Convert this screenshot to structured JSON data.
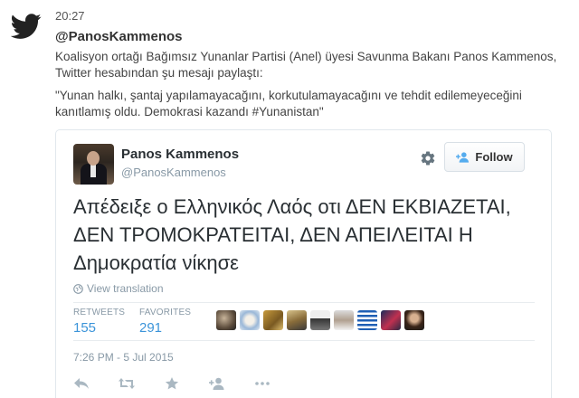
{
  "header": {
    "time": "20:27",
    "handle": "@PanosKammenos",
    "description": "Koalisyon ortağı Bağımsız Yunanlar Partisi (Anel) üyesi Savunma Bakanı Panos Kammenos, Twitter hesabından şu mesajı paylaştı:",
    "quote": "\"Yunan halkı, şantaj yapılamayacağını, korkutulamayacağını ve tehdit edilemeyeceğini kanıtlamış oldu. Demokrasi kazandı #Yunanistan\""
  },
  "tweet": {
    "name": "Panos Kammenos",
    "screen_name": "@PanosKammenos",
    "follow_label": "Follow",
    "text": "Απέδειξε ο Ελληνικός Λαός οτι ΔΕΝ ΕΚΒΙΑΖΕΤΑΙ, ΔΕΝ ΤΡΟΜΟΚΡΑΤΕΙΤΑΙ, ΔΕΝ ΑΠΕΙΛΕΙΤΑΙ Η Δημοκρατία νίκησε",
    "view_translation": "View translation",
    "stats": {
      "retweets_label": "RETWEETS",
      "retweets": "155",
      "favorites_label": "FAVORITES",
      "favorites": "291"
    },
    "timestamp": "7:26 PM - 5 Jul 2015"
  },
  "colors": {
    "twitter_blue": "#3b94d9",
    "bird": "#222222",
    "muted": "#8899a6"
  },
  "icons": [
    "twitter-bird-icon",
    "gear-icon",
    "follow-person-icon",
    "globe-icon",
    "reply-icon",
    "retweet-icon",
    "favorite-icon",
    "follow-action-icon",
    "more-icon"
  ]
}
